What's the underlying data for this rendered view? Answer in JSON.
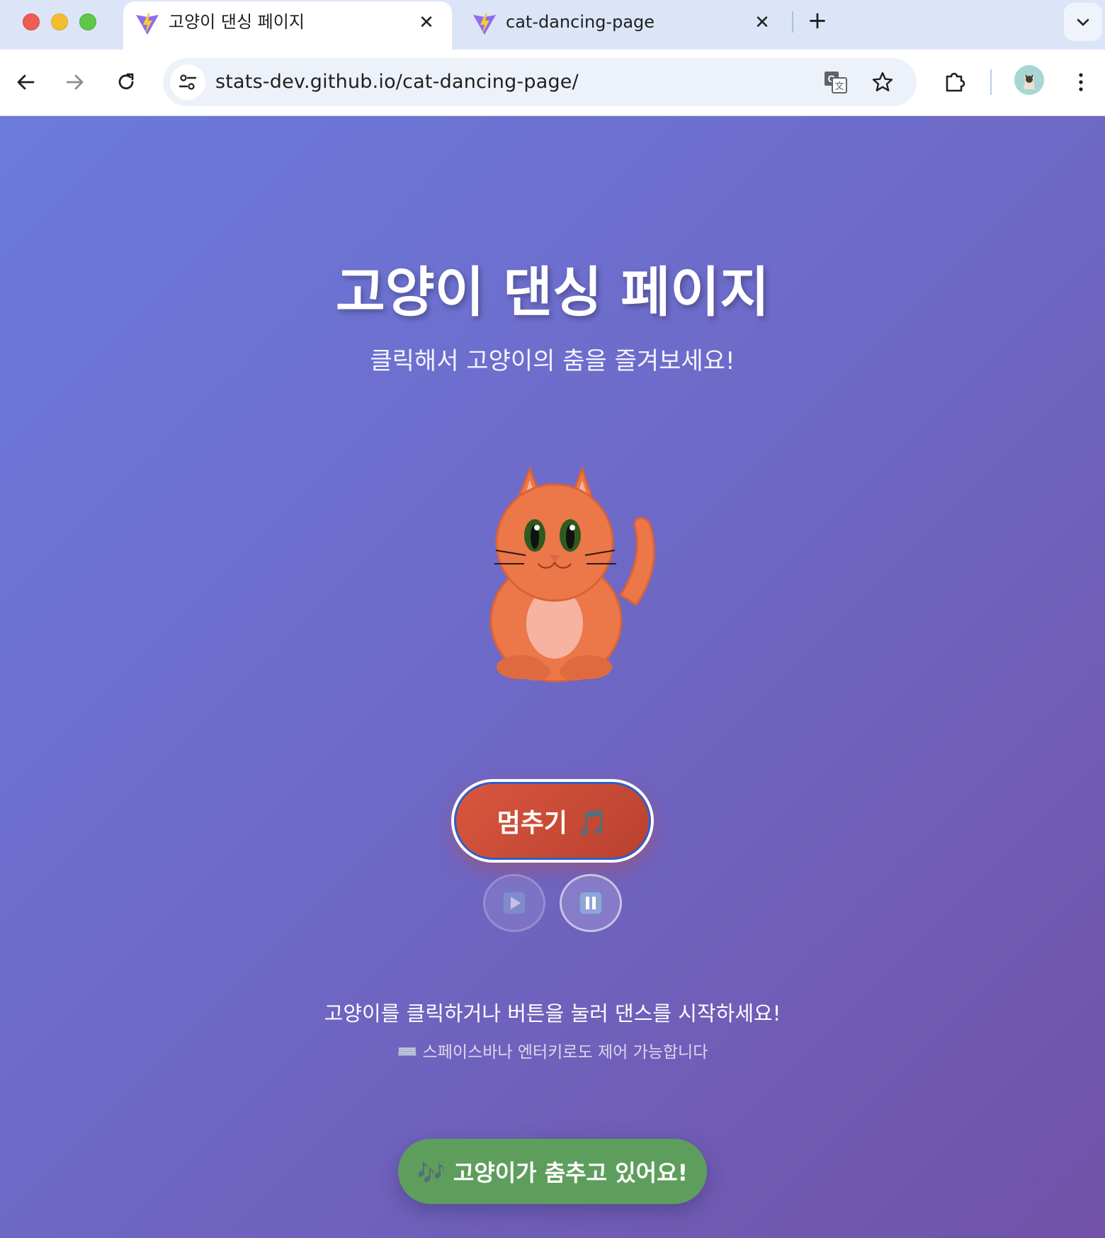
{
  "browser": {
    "tabs": [
      {
        "title": "고양이 댄싱 페이지",
        "active": true
      },
      {
        "title": "cat-dancing-page",
        "active": false
      }
    ],
    "address": "stats-dev.github.io/cat-dancing-page/"
  },
  "page": {
    "title": "고양이 댄싱 페이지",
    "subtitle": "클릭해서 고양이의 춤을 즐겨보세요!",
    "stop_button": "멈추기 🎵",
    "instruction": "고양이를 클릭하거나 버튼을 눌러 댄스를 시작하세요!",
    "hint": "⌨️ 스페이스바나 엔터키로도 제어 가능합니다",
    "status": "🎶 고양이가 춤추고 있어요!"
  },
  "colors": {
    "background_start": "#6b7bdc",
    "background_end": "#7152a8",
    "stop_button": "#c94a35",
    "status_badge": "#5e9e5c",
    "cat_body": "#ec7748",
    "cat_belly": "#f5b3a0",
    "cat_eyes": "#2f5a1e"
  },
  "icons": {
    "play": "play-icon",
    "pause": "pause-icon"
  }
}
